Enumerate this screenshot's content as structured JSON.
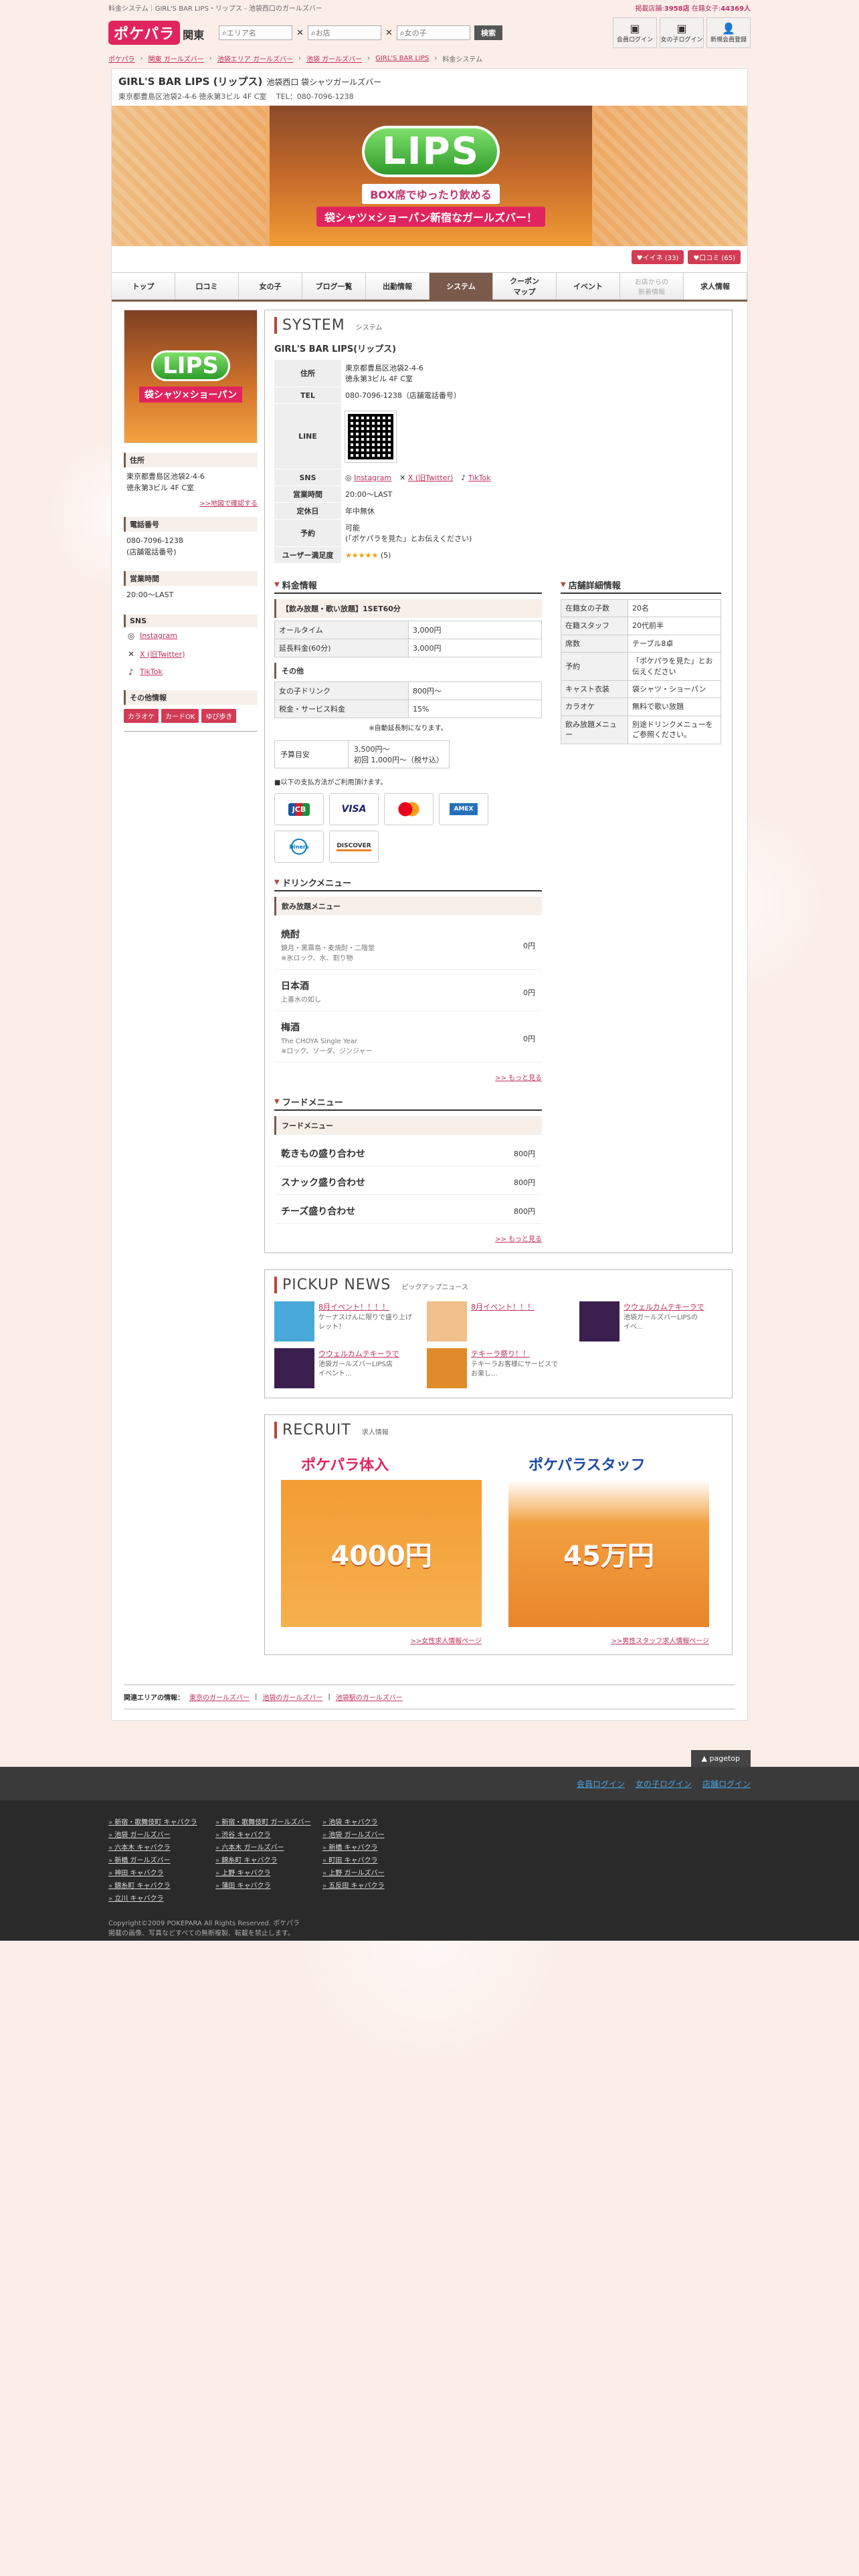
{
  "topline": {
    "left": "料金システム｜GIRL'S BAR LIPS・リップス - 池袋西口のガールズバー",
    "shops_label": "掲載店舗:",
    "shops_count": "3958店",
    "cast_label": "在籍女子:",
    "cast_count": "44369人"
  },
  "header": {
    "logo_main": "ポケパラ",
    "logo_sub": "関東",
    "search_area_placeholder": "エリア名",
    "search_shop_placeholder": "お店",
    "search_girl_placeholder": "女の子",
    "search_btn": "検索",
    "actions": [
      {
        "icon": "▣",
        "label": "会員ログイン"
      },
      {
        "icon": "▣",
        "label": "女の子ログイン"
      },
      {
        "icon": "👤",
        "label": "新規会員登録"
      }
    ]
  },
  "breadcrumb": [
    "ポケパラ",
    "関東 ガールズバー",
    "池袋エリア ガールズバー",
    "池袋 ガールズバー",
    "GIRL'S BAR LIPS",
    "料金システム"
  ],
  "shop": {
    "name": "GIRL'S BAR LIPS (リップス)",
    "name_sub": "池袋西口 袋シャツガールズバー",
    "address_line": "東京都豊島区池袋2-4-6 徳永第3ビル 4F C室　 TEL：080-7096-1238"
  },
  "banner": {
    "logo": "LIPS",
    "tag1": "BOX席でゆったり飲める",
    "tag2": "袋シャツ×ショーパン新宿なガールズバー！"
  },
  "badges": [
    "♥イイネ (33)",
    "♥口コミ (65)"
  ],
  "tabs": [
    {
      "label": "トップ"
    },
    {
      "label": "口コミ"
    },
    {
      "label": "女の子"
    },
    {
      "label": "ブログ一覧"
    },
    {
      "label": "出勤情報"
    },
    {
      "label": "システム"
    },
    {
      "label": "クーポン\nマップ"
    },
    {
      "label": "イベント"
    },
    {
      "label": "お店からの\n新着情報"
    },
    {
      "label": "求人情報"
    }
  ],
  "left": {
    "thumb_logo": "LIPS",
    "thumb_tag": "袋シャツ×ショーパン",
    "address_h": "住所",
    "address": "東京都豊島区池袋2-4-6\n徳永第3ビル 4F C室",
    "map_link": ">>地図で確認する",
    "phone_h": "電話番号",
    "phone": "080-7096-1238\n(店舗電話番号)",
    "hours_h": "営業時間",
    "hours": "20:00〜LAST",
    "sns_h": "SNS",
    "sns": [
      {
        "icon": "◎",
        "label": "Instagram"
      },
      {
        "icon": "✕",
        "label": "X (旧Twitter)"
      },
      {
        "icon": "♪",
        "label": "TikTok"
      }
    ],
    "other_h": "その他情報",
    "chips": [
      "カラオケ",
      "カードOK",
      "ゆび歩き"
    ]
  },
  "system": {
    "title_en": "SYSTEM",
    "title_jp": "システム",
    "shop_name": "GIRL'S BAR LIPS(リップス)",
    "rows": {
      "address_k": "住所",
      "address_v": "東京都豊島区池袋2-4-6\n徳永第3ビル 4F C室",
      "tel_k": "TEL",
      "tel_v": "080-7096-1238（店舗電話番号）",
      "line_k": "LINE",
      "sns_k": "SNS",
      "sns_instagram": "Instagram",
      "sns_x": "X (旧Twitter)",
      "sns_tiktok": "TikTok",
      "hours_k": "営業時間",
      "hours_v": "20:00〜LAST",
      "holiday_k": "定休日",
      "holiday_v": "年中無休",
      "reserve_k": "予約",
      "reserve_v": "可能\n(「ポケパラを見た」とお伝えください)",
      "rating_k": "ユーザー満足度",
      "rating_stars": "★★★★★",
      "rating_v": "(5)"
    }
  },
  "price": {
    "h": "料金情報",
    "set_h": "【飲み放題・歌い放題】1SET60分",
    "set_rows": [
      [
        "オールタイム",
        "3,000円"
      ],
      [
        "延長料金(60分)",
        "3,000円"
      ]
    ],
    "other_h": "その他",
    "other_rows": [
      [
        "女の子ドリンク",
        "800円〜"
      ],
      [
        "税金・サービス料金",
        "15%"
      ]
    ],
    "note": "※自動延長制になります。",
    "budget_k": "予算目安",
    "budget_v": "3,500円〜\n初回 1,000円〜（税サ込）",
    "pay_note": "■以下の支払方法がご利用頂けます。",
    "cards": [
      "JCB",
      "VISA",
      "",
      "AMEX",
      "Diners",
      "DISCOVER"
    ]
  },
  "detail": {
    "h": "店舗詳細情報",
    "rows": [
      [
        "在籍女の子数",
        "20名"
      ],
      [
        "在籍スタッフ",
        "20代前半"
      ],
      [
        "席数",
        "テーブル8卓"
      ],
      [
        "予約",
        "「ポケパラを見た」とお伝えください"
      ],
      [
        "キャスト衣装",
        "袋シャツ・ショーパン"
      ],
      [
        "カラオケ",
        "無料で歌い放題"
      ],
      [
        "飲み放題メニュー",
        "別途ドリンクメニューをご参照ください。"
      ]
    ]
  },
  "drink": {
    "h": "ドリンクメニュー",
    "bar": "飲み放題メニュー",
    "items": [
      {
        "name": "焼酎",
        "desc": "鏡月・黒霧島・麦焼酎・二階堂\n※氷ロック、水、割り物",
        "price": "0円"
      },
      {
        "name": "日本酒",
        "desc": "上善水の如し",
        "price": "0円"
      },
      {
        "name": "梅酒",
        "desc": "The CHOYA Single Year\n※ロック、ソーダ、ジンジャー",
        "price": "0円"
      }
    ],
    "more": ">> もっと見る"
  },
  "food": {
    "h": "フードメニュー",
    "bar": "フードメニュー",
    "items": [
      {
        "name": "乾きもの盛り合わせ",
        "price": "800円"
      },
      {
        "name": "スナック盛り合わせ",
        "price": "800円"
      },
      {
        "name": "チーズ盛り合わせ",
        "price": "800円"
      }
    ],
    "more": ">> もっと見る"
  },
  "pickup": {
    "title_en": "PICKUP NEWS",
    "title_jp": "ピックアップニュース",
    "items": [
      {
        "t": "8月イベント！！！！",
        "d": "ケーナスけんに限りで盛り上げ\nレット！",
        "color": "#48a8d8"
      },
      {
        "t": "8月イベント！！！",
        "d": "",
        "color": "#f2c08a"
      },
      {
        "t": "ウウェルカムテキーラで",
        "d": "池袋ガールズバーLIPSの\nイベ...",
        "color": "#3a1f4f"
      },
      {
        "t": "ウウェルカムテキーラで",
        "d": "池袋ガールズバーLIPS店\nイベント...",
        "color": "#3a1f4f"
      },
      {
        "t": "テキーラ祭り！！",
        "d": "テキーラお客様にサービスで\nお楽し...",
        "color": "#e08a2c"
      }
    ]
  },
  "recruit": {
    "title_en": "RECRUIT",
    "title_jp": "求人情報",
    "items": [
      {
        "logo": "ポケパラ体入",
        "img": "4000円",
        "link": ">>女性求人情報ページ"
      },
      {
        "logo": "ポケパラスタッフ",
        "img": "45万円",
        "link": ">>男性スタッフ求人情報ページ"
      }
    ]
  },
  "related": {
    "label": "関連エリアの情報：",
    "links": [
      "東京のガールズバー",
      "池袋のガールズバー",
      "池袋駅のガールズバー"
    ]
  },
  "footer": {
    "pagetop": "pagetop",
    "bar_links": [
      "会員ログイン",
      "女の子ログイン",
      "店舗ログイン"
    ],
    "links": [
      "新宿・歌舞伎町 キャバクラ",
      "新宿・歌舞伎町 ガールズバー",
      "池袋 キャバクラ",
      "池袋 ガールズバー",
      "渋谷 キャバクラ",
      "池袋 ガールズバー",
      "六本木 キャバクラ",
      "六本木 ガールズバー",
      "新橋 キャバクラ",
      "新橋 ガールズバー",
      "錦糸町 キャバクラ",
      "町田 キャバクラ",
      "神田 キャバクラ",
      "上野 キャバクラ",
      "上野 ガールズバー",
      "錦糸町 キャバクラ",
      "蒲田 キャバクラ",
      "五反田 キャバクラ",
      "立川 キャバクラ"
    ],
    "copy": "Copyright©2009 POKEPARA All Rights Reserved. ポケパラ\n掲載の画像、写真などすべての無断複製、転載を禁止します。"
  }
}
